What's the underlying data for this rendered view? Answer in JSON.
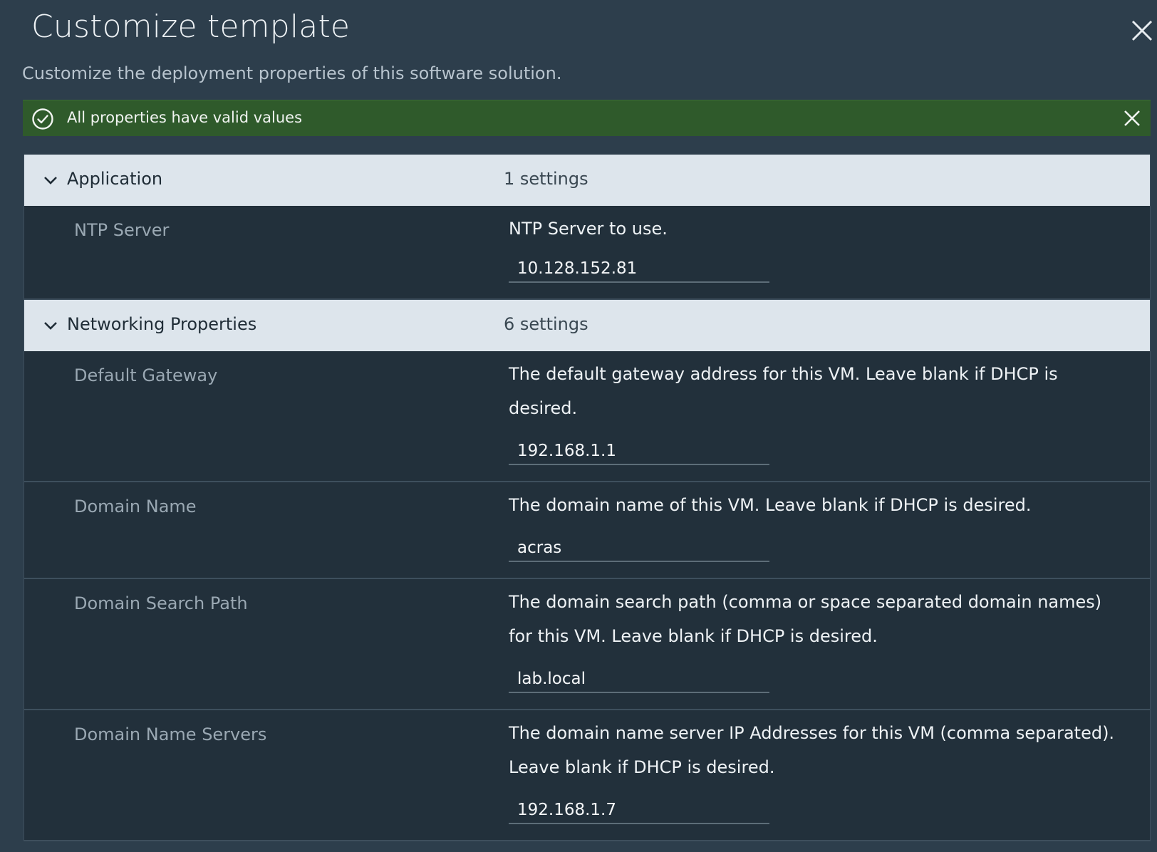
{
  "dialog": {
    "title": "Customize template",
    "subtitle": "Customize the deployment properties of this software solution."
  },
  "alert": {
    "text": "All properties have valid values",
    "icon": "check-circle-icon",
    "color": "#2f5a2b"
  },
  "groups": [
    {
      "name": "Application",
      "count": "1 settings",
      "properties": [
        {
          "label": "NTP Server",
          "description": "NTP Server to use.",
          "value": "10.128.152.81"
        }
      ]
    },
    {
      "name": "Networking Properties",
      "count": "6 settings",
      "properties": [
        {
          "label": "Default Gateway",
          "description": "The default gateway address for this VM. Leave blank if DHCP is desired.",
          "value": "192.168.1.1"
        },
        {
          "label": "Domain Name",
          "description": "The domain name of this VM. Leave blank if DHCP is desired.",
          "value": "acras"
        },
        {
          "label": "Domain Search Path",
          "description": "The domain search path (comma or space separated domain names) for this VM. Leave blank if DHCP is desired.",
          "value": "lab.local"
        },
        {
          "label": "Domain Name Servers",
          "description": "The domain name server IP Addresses for this VM (comma separated). Leave blank if DHCP is desired.",
          "value": "192.168.1.7"
        }
      ]
    }
  ]
}
